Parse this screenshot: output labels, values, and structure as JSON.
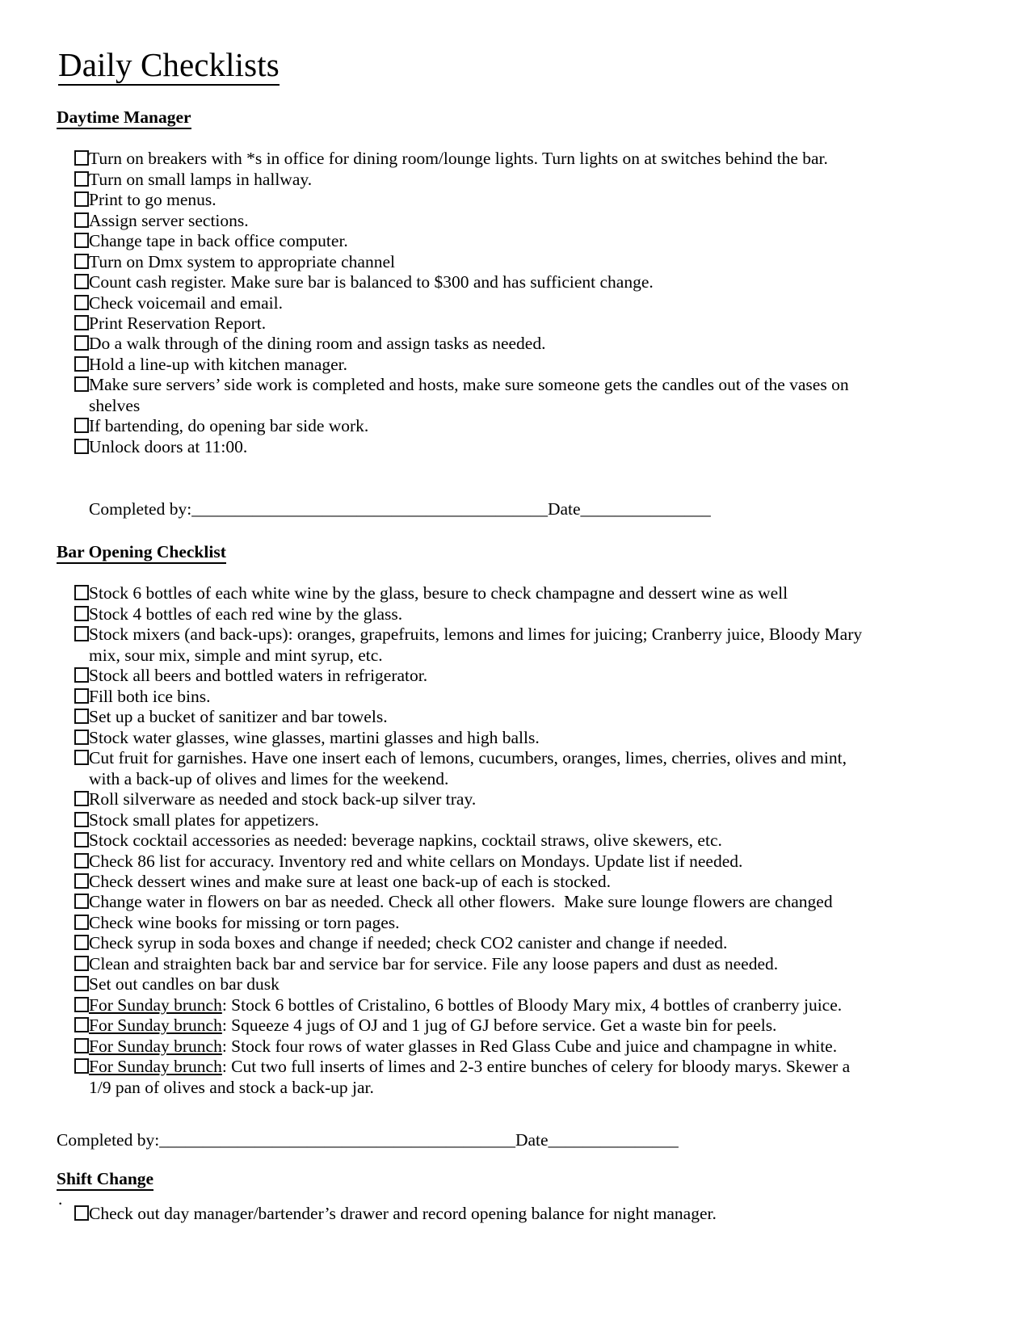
{
  "document": {
    "title": "Daily Checklists"
  },
  "sections": [
    {
      "heading": "Daytime Manager",
      "items": [
        "Turn on breakers with *s in office for dining room/lounge lights. Turn lights on at switches behind the bar.",
        "Turn on small lamps in hallway.",
        "Print to go menus.",
        "Assign server sections.",
        "Change tape in back office computer.",
        "Turn on Dmx system to appropriate channel",
        "Count cash register. Make sure bar is balanced to $300 and has sufficient change.",
        "Check voicemail and email.",
        "Print Reservation Report.",
        "Do a walk through of the dining room and assign tasks as needed.",
        "Hold a line-up with kitchen manager.",
        "Make sure servers’ side work is completed and hosts, make sure someone gets the candles out of the vases on shelves",
        "If bartending, do opening bar side work.",
        "Unlock doors at 11:00."
      ],
      "signoff": {
        "completed_label": "Completed by:",
        "completed_rule": "_________________________________________",
        "date_label": "Date",
        "date_rule": "_______________"
      }
    },
    {
      "heading": "Bar Opening Checklist",
      "items": [
        "Stock 6 bottles of each white wine by the glass, besure to check champagne and dessert wine as well",
        "Stock 4 bottles of each red wine by the glass.",
        "Stock mixers (and back-ups): oranges, grapefruits, lemons and limes for juicing; Cranberry juice, Bloody Mary mix, sour mix, simple and mint syrup, etc.",
        "Stock all beers and bottled waters in refrigerator.",
        "Fill both ice bins.",
        "Set up a bucket of sanitizer and bar towels.",
        "Stock water glasses, wine glasses, martini glasses and high balls.",
        "Cut fruit for garnishes. Have one insert each of lemons, cucumbers, oranges, limes, cherries, olives and mint, with a back-up of olives and limes for the weekend.",
        "Roll silverware as needed and stock back-up silver tray.",
        "Stock small plates for appetizers.",
        "Stock cocktail accessories as needed: beverage napkins, cocktail straws, olive skewers, etc.",
        "Check 86 list for accuracy. Inventory red and white cellars on Mondays. Update list if needed.",
        "Check dessert wines and make sure at least one back-up of each is stocked.",
        "Change water in flowers on bar as needed. Check all other flowers.  Make sure lounge flowers are changed",
        "Check wine books for missing or torn pages.",
        "Check syrup in soda boxes and change if needed; check CO2 canister and change if needed.",
        "Clean and straighten back bar and service bar for service. File any loose papers and dust as needed.",
        "Set out candles on bar dusk"
      ],
      "underlined_prefix": "For Sunday brunch",
      "brunch_items": [
        ": Stock 6 bottles of Cristalino, 6 bottles of Bloody Mary mix, 4 bottles of cranberry juice.",
        ": Squeeze 4 jugs of OJ and 1 jug of GJ before service. Get a waste bin for peels.",
        ": Stock four rows of water glasses in Red Glass Cube and juice and champagne in white.",
        ": Cut two full inserts of limes and 2-3 entire bunches of celery for bloody marys. Skewer a 1/9 pan of olives and stock a back-up jar."
      ],
      "signoff": {
        "completed_label": "Completed by:",
        "completed_rule": "_________________________________________",
        "date_label": "Date",
        "date_rule": "_______________"
      }
    },
    {
      "heading": "Shift Change",
      "stray_mark": ".",
      "items": [
        "Check out day manager/bartender’s drawer and record opening balance for night manager."
      ]
    }
  ]
}
